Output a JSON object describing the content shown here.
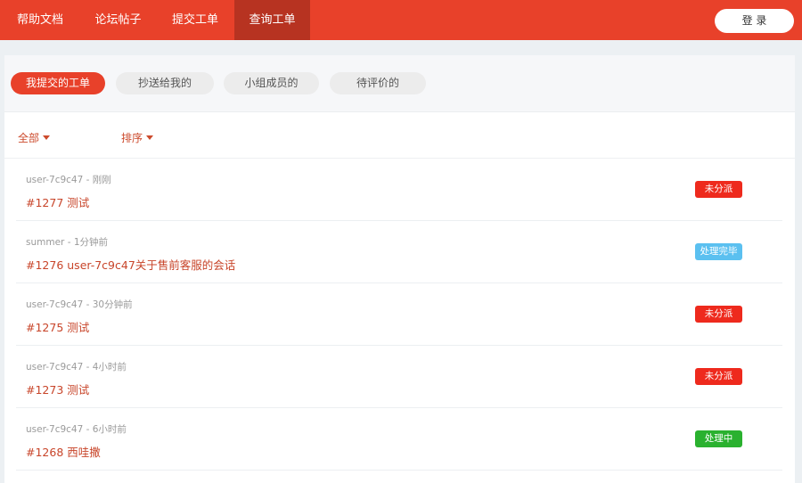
{
  "nav": {
    "tabs": [
      {
        "label": "帮助文档",
        "active": false
      },
      {
        "label": "论坛帖子",
        "active": false
      },
      {
        "label": "提交工单",
        "active": false
      },
      {
        "label": "查询工单",
        "active": true
      }
    ],
    "login_label": "登 录"
  },
  "filters": {
    "tabs": [
      {
        "label": "我提交的工单",
        "active": true
      },
      {
        "label": "抄送给我的",
        "active": false
      },
      {
        "label": "小组成员的",
        "active": false
      },
      {
        "label": "待评价的",
        "active": false
      }
    ]
  },
  "sort_bar": {
    "scope_label": "全部",
    "sort_label": "排序"
  },
  "tickets": [
    {
      "meta": "user-7c9c47 - 刚刚",
      "title": "#1277 测试",
      "status": "未分派",
      "status_color": "#ee2a1d"
    },
    {
      "meta": "summer - 1分钟前",
      "title": "#1276 user-7c9c47关于售前客服的会话",
      "status": "处理完毕",
      "status_color": "#5bc0f0"
    },
    {
      "meta": "user-7c9c47 - 30分钟前",
      "title": "#1275 测试",
      "status": "未分派",
      "status_color": "#ee2a1d"
    },
    {
      "meta": "user-7c9c47 - 4小时前",
      "title": "#1273 测试",
      "status": "未分派",
      "status_color": "#ee2a1d"
    },
    {
      "meta": "user-7c9c47 - 6小时前",
      "title": "#1268 西哇撒",
      "status": "处理中",
      "status_color": "#2ab12f"
    }
  ],
  "colors": {
    "brand": "#e8412a",
    "brand_dark": "#b73321",
    "link": "#c8452a"
  }
}
